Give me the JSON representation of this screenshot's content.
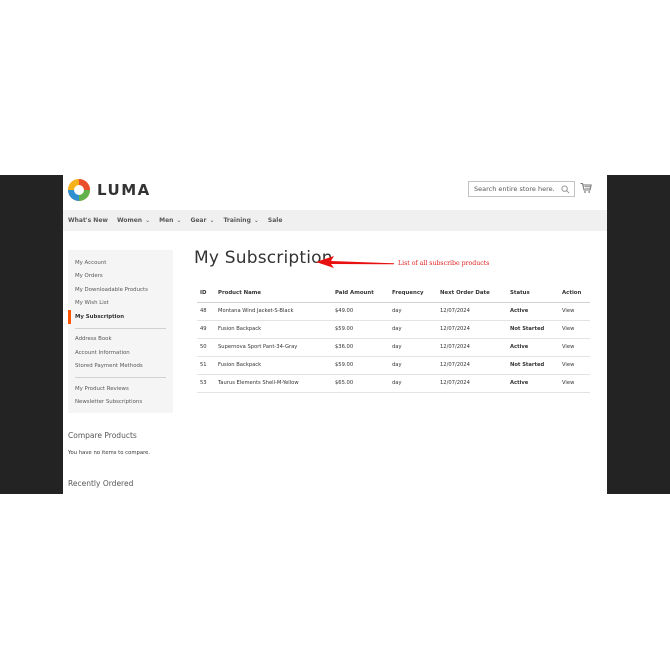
{
  "header": {
    "logo_text": "LUMA",
    "search_placeholder": "Search entire store here..."
  },
  "nav": {
    "items": [
      {
        "label": "What's New",
        "has_dropdown": false
      },
      {
        "label": "Women",
        "has_dropdown": true
      },
      {
        "label": "Men",
        "has_dropdown": true
      },
      {
        "label": "Gear",
        "has_dropdown": true
      },
      {
        "label": "Training",
        "has_dropdown": true
      },
      {
        "label": "Sale",
        "has_dropdown": false
      }
    ]
  },
  "account_nav": {
    "group1": [
      "My Account",
      "My Orders",
      "My Downloadable Products",
      "My Wish List"
    ],
    "current": "My Subscription",
    "group2": [
      "Address Book",
      "Account Information",
      "Stored Payment Methods"
    ],
    "group3": [
      "My Product Reviews",
      "Newsletter Subscriptions"
    ]
  },
  "compare": {
    "title": "Compare Products",
    "text": "You have no items to compare."
  },
  "recent": {
    "title": "Recently Ordered"
  },
  "main": {
    "title": "My Subscription",
    "annotation": "List of all subscribe products"
  },
  "table": {
    "headers": [
      "ID",
      "Product Name",
      "Paid Amount",
      "Frequency",
      "Next Order Date",
      "Status",
      "Action"
    ],
    "rows": [
      {
        "id": "48",
        "product": "Montana Wind Jacket-S-Black",
        "amount": "$49.00",
        "frequency": "day",
        "next_date": "12/07/2024",
        "status": "Active",
        "action": "View"
      },
      {
        "id": "49",
        "product": "Fusion Backpack",
        "amount": "$59.00",
        "frequency": "day",
        "next_date": "12/07/2024",
        "status": "Not Started",
        "action": "View"
      },
      {
        "id": "50",
        "product": "Supernova Sport Pant-34-Gray",
        "amount": "$36.00",
        "frequency": "day",
        "next_date": "12/07/2024",
        "status": "Active",
        "action": "View"
      },
      {
        "id": "51",
        "product": "Fusion Backpack",
        "amount": "$59.00",
        "frequency": "day",
        "next_date": "12/07/2024",
        "status": "Not Started",
        "action": "View"
      },
      {
        "id": "53",
        "product": "Taurus Elements Shell-M-Yellow",
        "amount": "$65.00",
        "frequency": "day",
        "next_date": "12/07/2024",
        "status": "Active",
        "action": "View"
      }
    ]
  },
  "colors": {
    "accent_orange": "#ff5501",
    "status_active": "#59c91b",
    "status_not_started": "#ff7d1a",
    "link": "#1979c3",
    "annotation": "#e02020"
  }
}
